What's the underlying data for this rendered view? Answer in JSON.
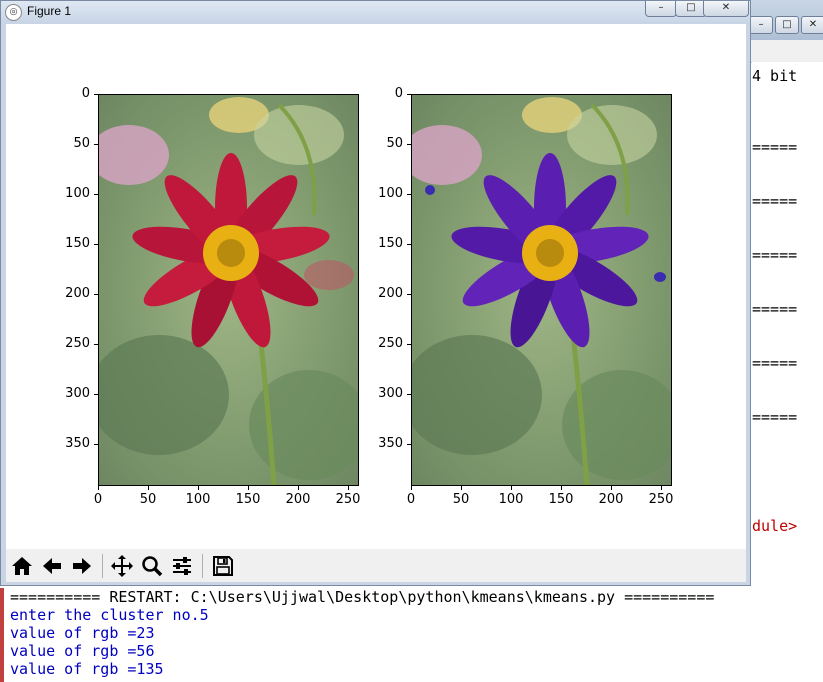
{
  "figure": {
    "title": "Figure 1",
    "controls": {
      "minimize": "–",
      "maximize": "□",
      "close": "✕"
    },
    "toolbar": [
      "home-icon",
      "back-icon",
      "forward-icon",
      "pan-icon",
      "zoom-icon",
      "configure-subplots-icon",
      "save-icon"
    ]
  },
  "plots": {
    "y_ticks": [
      "0",
      "50",
      "100",
      "150",
      "200",
      "250",
      "300",
      "350"
    ],
    "x_ticks": [
      "0",
      "50",
      "100",
      "150",
      "200",
      "250"
    ],
    "left_image": "Original flower photo (red petals)",
    "right_image": "K-means clustered flower photo (purple petals)"
  },
  "shell": {
    "controls": {
      "minimize": "–",
      "maximize": "□",
      "close": "✕"
    },
    "fragments": [
      {
        "text": "4 bit",
        "color": "black"
      },
      {
        "text": "=====",
        "color": "black"
      },
      {
        "text": "=====",
        "color": "black"
      },
      {
        "text": "=====",
        "color": "black"
      },
      {
        "text": "=====",
        "color": "black"
      },
      {
        "text": "=====",
        "color": "black"
      },
      {
        "text": "=====",
        "color": "black"
      },
      {
        "text": "dule>",
        "color": "red"
      }
    ]
  },
  "console": {
    "lines": [
      "========== RESTART: C:\\Users\\Ujjwal\\Desktop\\python\\kmeans\\kmeans.py ==========",
      "enter the cluster no.5",
      "value of rgb =23",
      "value of rgb =56",
      "value of rgb =135"
    ]
  },
  "colors": {
    "flower_red": "#c0183a",
    "flower_purple": "#5a1fb0",
    "center_yellow": "#e8b012",
    "console_blue": "#0000c0"
  }
}
